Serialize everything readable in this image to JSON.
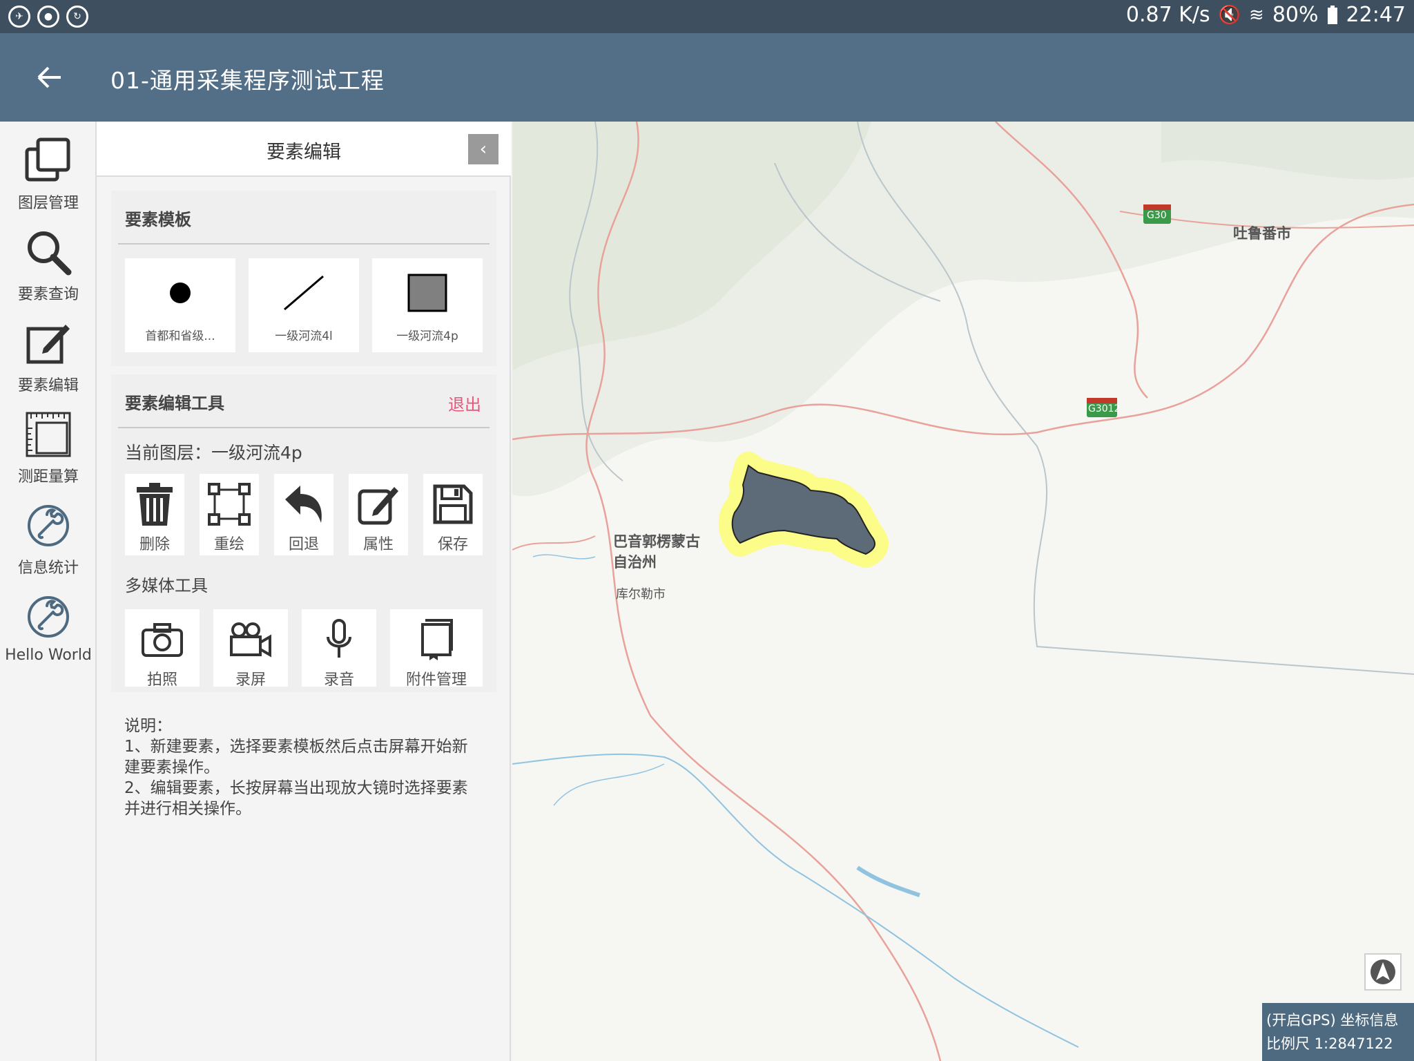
{
  "status_bar": {
    "net_speed": "0.87 K/s",
    "battery": "80%",
    "time": "22:47"
  },
  "app_bar": {
    "title": "01-通用采集程序测试工程"
  },
  "rail": {
    "items": [
      {
        "label": "图层管理",
        "icon": "layers-icon"
      },
      {
        "label": "要素查询",
        "icon": "search-icon"
      },
      {
        "label": "要素编辑",
        "icon": "edit-icon"
      },
      {
        "label": "测距量算",
        "icon": "ruler-icon"
      },
      {
        "label": "信息统计",
        "icon": "wrench-icon"
      },
      {
        "label": "Hello World",
        "icon": "wrench-icon"
      }
    ]
  },
  "panel": {
    "title": "要素编辑",
    "template_card": {
      "title": "要素模板",
      "templates": [
        {
          "label": "首都和省级...",
          "shape": "point"
        },
        {
          "label": "一级河流4l",
          "shape": "line"
        },
        {
          "label": "一级河流4p",
          "shape": "polygon"
        }
      ]
    },
    "tools_card": {
      "title": "要素编辑工具",
      "exit_label": "退出",
      "current_layer": "当前图层：一级河流4p",
      "tools": [
        {
          "label": "删除",
          "icon": "trash-icon"
        },
        {
          "label": "重绘",
          "icon": "redraw-icon"
        },
        {
          "label": "回退",
          "icon": "undo-icon"
        },
        {
          "label": "属性",
          "icon": "attributes-icon"
        },
        {
          "label": "保存",
          "icon": "save-icon"
        }
      ],
      "multimedia_title": "多媒体工具",
      "multimedia": [
        {
          "label": "拍照",
          "icon": "camera-icon"
        },
        {
          "label": "录屏",
          "icon": "video-camera-icon"
        },
        {
          "label": "录音",
          "icon": "microphone-icon"
        },
        {
          "label": "附件管理",
          "icon": "attachment-icon"
        }
      ]
    },
    "notes": {
      "heading": "说明：",
      "line1": "1、新建要素，选择要素模板然后点击屏幕开始新建要素操作。",
      "line2": "2、编辑要素，长按屏幕当出现放大镜时选择要素并进行相关操作。"
    }
  },
  "map": {
    "labels": {
      "turpan": "吐鲁番市",
      "bayin_line1": "巴音郭楞蒙古",
      "bayin_line2": "自治州",
      "korla": "库尔勒市",
      "shield_g30": "G30",
      "shield_g3012": "G3012"
    },
    "gps_info": "(开启GPS) 坐标信息",
    "scale": "比例尺 1:2847122",
    "colors": {
      "highlight": "#ffff00",
      "polygon_fill": "#5c6b77",
      "road": "#e8a29a",
      "river": "#8fc3e0",
      "highway_shield": "#3a9a4a"
    }
  }
}
